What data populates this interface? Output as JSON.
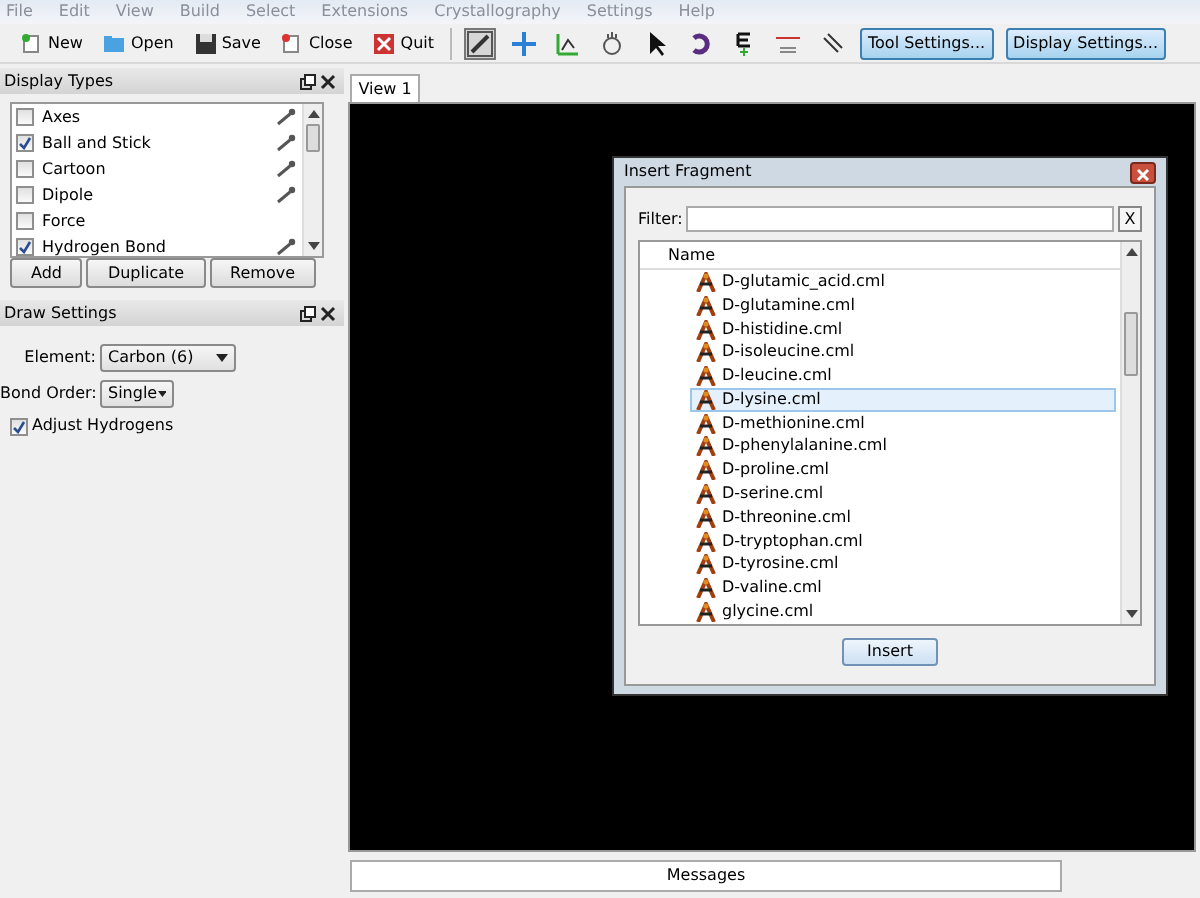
{
  "menu": [
    "File",
    "Edit",
    "View",
    "Build",
    "Select",
    "Extensions",
    "Crystallography",
    "Settings",
    "Help"
  ],
  "toolbar": {
    "actions": [
      {
        "kind": "new",
        "label": "New"
      },
      {
        "kind": "open",
        "label": "Open"
      },
      {
        "kind": "save",
        "label": "Save"
      },
      {
        "kind": "close",
        "label": "Close"
      },
      {
        "kind": "quit",
        "label": "Quit"
      }
    ],
    "tools": [
      {
        "kind": "draw",
        "selected": true
      },
      {
        "kind": "navigate",
        "selected": false
      },
      {
        "kind": "measure",
        "selected": false
      },
      {
        "kind": "hand",
        "selected": false
      },
      {
        "kind": "select",
        "selected": false
      },
      {
        "kind": "rotate",
        "selected": false
      },
      {
        "kind": "element",
        "selected": false
      },
      {
        "kind": "bond",
        "selected": false
      },
      {
        "kind": "align",
        "selected": false
      }
    ],
    "buttons": [
      "Tool Settings...",
      "Display Settings..."
    ]
  },
  "display_types": {
    "title": "Display Types",
    "items": [
      {
        "label": "Axes",
        "checked": false,
        "settings": true
      },
      {
        "label": "Ball and Stick",
        "checked": true,
        "settings": true
      },
      {
        "label": "Cartoon",
        "checked": false,
        "settings": true
      },
      {
        "label": "Dipole",
        "checked": false,
        "settings": true
      },
      {
        "label": "Force",
        "checked": false,
        "settings": false
      },
      {
        "label": "Hydrogen Bond",
        "checked": true,
        "settings": true
      }
    ],
    "buttons": [
      "Add",
      "Duplicate",
      "Remove"
    ]
  },
  "draw_settings": {
    "title": "Draw Settings",
    "element_label": "Element:",
    "element": "Carbon (6)",
    "bond_order_label": "Bond Order:",
    "bond_order": "Single",
    "adjust_hydrogens": {
      "label": "Adjust Hydrogens",
      "checked": true
    }
  },
  "view_tabs": [
    {
      "label": "View 1",
      "selected": true
    }
  ],
  "dialog": {
    "title": "Insert Fragment",
    "filter_label": "Filter:",
    "clear_button": "X",
    "column": "Name",
    "files": [
      {
        "name": "D-glutamic_acid.cml",
        "selected": false
      },
      {
        "name": "D-glutamine.cml",
        "selected": false
      },
      {
        "name": "D-histidine.cml",
        "selected": false
      },
      {
        "name": "D-isoleucine.cml",
        "selected": false
      },
      {
        "name": "D-leucine.cml",
        "selected": false
      },
      {
        "name": "D-lysine.cml",
        "selected": true
      },
      {
        "name": "D-methionine.cml",
        "selected": false
      },
      {
        "name": "D-phenylalanine.cml",
        "selected": false
      },
      {
        "name": "D-proline.cml",
        "selected": false
      },
      {
        "name": "D-serine.cml",
        "selected": false
      },
      {
        "name": "D-threonine.cml",
        "selected": false
      },
      {
        "name": "D-tryptophan.cml",
        "selected": false
      },
      {
        "name": "D-tyrosine.cml",
        "selected": false
      },
      {
        "name": "D-valine.cml",
        "selected": false
      },
      {
        "name": "glycine.cml",
        "selected": false
      }
    ],
    "button": "Insert"
  },
  "messages_tab": "Messages"
}
